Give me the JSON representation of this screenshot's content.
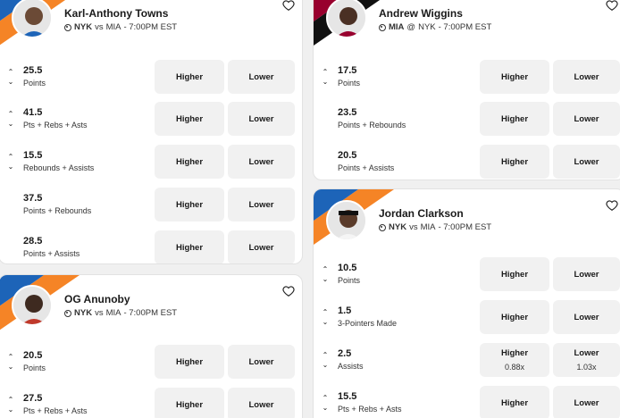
{
  "colors": {
    "nyk_blue": "#1d64b8",
    "nyk_orange": "#f58426",
    "mia_red": "#98002e",
    "mia_black": "#111111"
  },
  "labels": {
    "higher": "Higher",
    "lower": "Lower"
  },
  "cards": [
    {
      "player": "Karl-Anthony Towns",
      "team": "NYK",
      "connector": "vs",
      "opponent": "MIA",
      "time": "- 7:00PM EST",
      "icons": {
        "favorite": "heart-icon"
      },
      "props": [
        {
          "line": "25.5",
          "stat": "Points",
          "arrows": true
        },
        {
          "line": "41.5",
          "stat": "Pts + Rebs + Asts",
          "arrows": true
        },
        {
          "line": "15.5",
          "stat": "Rebounds + Assists",
          "arrows": true
        },
        {
          "line": "37.5",
          "stat": "Points + Rebounds",
          "arrows": false
        },
        {
          "line": "28.5",
          "stat": "Points + Assists",
          "arrows": false
        }
      ]
    },
    {
      "player": "OG Anunoby",
      "team": "NYK",
      "connector": "vs",
      "opponent": "MIA",
      "time": "- 7:00PM EST",
      "icons": {
        "favorite": "heart-icon"
      },
      "props": [
        {
          "line": "20.5",
          "stat": "Points",
          "arrows": true
        },
        {
          "line": "27.5",
          "stat": "Pts + Rebs + Asts",
          "arrows": true
        }
      ]
    },
    {
      "player": "Andrew Wiggins",
      "team": "MIA",
      "connector": "@",
      "opponent": "NYK",
      "time": "- 7:00PM EST",
      "icons": {
        "favorite": "heart-icon"
      },
      "props": [
        {
          "line": "17.5",
          "stat": "Points",
          "arrows": true
        },
        {
          "line": "23.5",
          "stat": "Points + Rebounds",
          "arrows": false
        },
        {
          "line": "20.5",
          "stat": "Points + Assists",
          "arrows": false
        }
      ]
    },
    {
      "player": "Jordan Clarkson",
      "team": "NYK",
      "connector": "vs",
      "opponent": "MIA",
      "time": "- 7:00PM EST",
      "icons": {
        "favorite": "heart-icon"
      },
      "props": [
        {
          "line": "10.5",
          "stat": "Points",
          "arrows": true
        },
        {
          "line": "1.5",
          "stat": "3-Pointers Made",
          "arrows": true
        },
        {
          "line": "2.5",
          "stat": "Assists",
          "arrows": true,
          "higher_mult": "0.88x",
          "lower_mult": "1.03x"
        },
        {
          "line": "15.5",
          "stat": "Pts + Rebs + Asts",
          "arrows": true
        }
      ]
    }
  ]
}
